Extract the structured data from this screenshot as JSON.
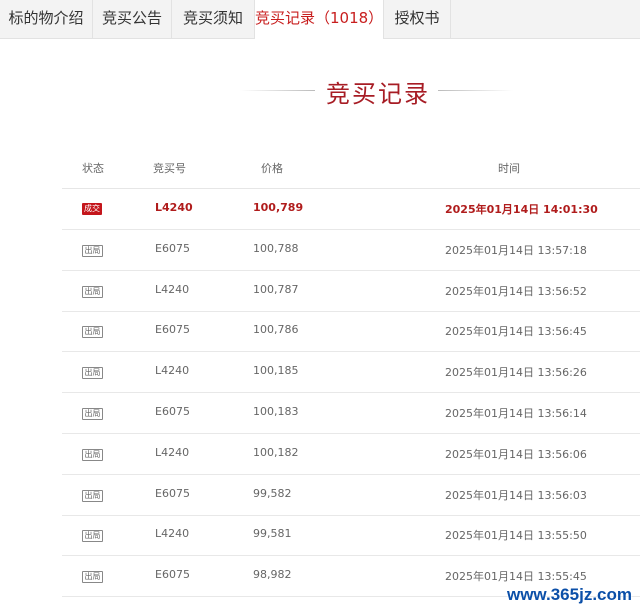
{
  "tabs": [
    {
      "label": "标的物介绍"
    },
    {
      "label": "竞买公告"
    },
    {
      "label": "竞买须知"
    },
    {
      "label": "竞买记录（1018）"
    },
    {
      "label": "授权书"
    }
  ],
  "heading": "竞买记录",
  "table": {
    "headers": {
      "status": "状态",
      "bid_no": "竞买号",
      "price": "价格",
      "time": "时间"
    },
    "rows": [
      {
        "status": "成交",
        "bid_no": "L4240",
        "price": "100,789",
        "time": "2025年01月14日 14:01:30"
      },
      {
        "status": "出局",
        "bid_no": "E6075",
        "price": "100,788",
        "time": "2025年01月14日 13:57:18"
      },
      {
        "status": "出局",
        "bid_no": "L4240",
        "price": "100,787",
        "time": "2025年01月14日 13:56:52"
      },
      {
        "status": "出局",
        "bid_no": "E6075",
        "price": "100,786",
        "time": "2025年01月14日 13:56:45"
      },
      {
        "status": "出局",
        "bid_no": "L4240",
        "price": "100,185",
        "time": "2025年01月14日 13:56:26"
      },
      {
        "status": "出局",
        "bid_no": "E6075",
        "price": "100,183",
        "time": "2025年01月14日 13:56:14"
      },
      {
        "status": "出局",
        "bid_no": "L4240",
        "price": "100,182",
        "time": "2025年01月14日 13:56:06"
      },
      {
        "status": "出局",
        "bid_no": "E6075",
        "price": "99,582",
        "time": "2025年01月14日 13:56:03"
      },
      {
        "status": "出局",
        "bid_no": "L4240",
        "price": "99,581",
        "time": "2025年01月14日 13:55:50"
      },
      {
        "status": "出局",
        "bid_no": "E6075",
        "price": "98,982",
        "time": "2025年01月14日 13:55:45"
      }
    ]
  },
  "watermark": "www.365jz.com",
  "colors": {
    "accent": "#c81e1e",
    "win_badge": "#c4161c"
  }
}
